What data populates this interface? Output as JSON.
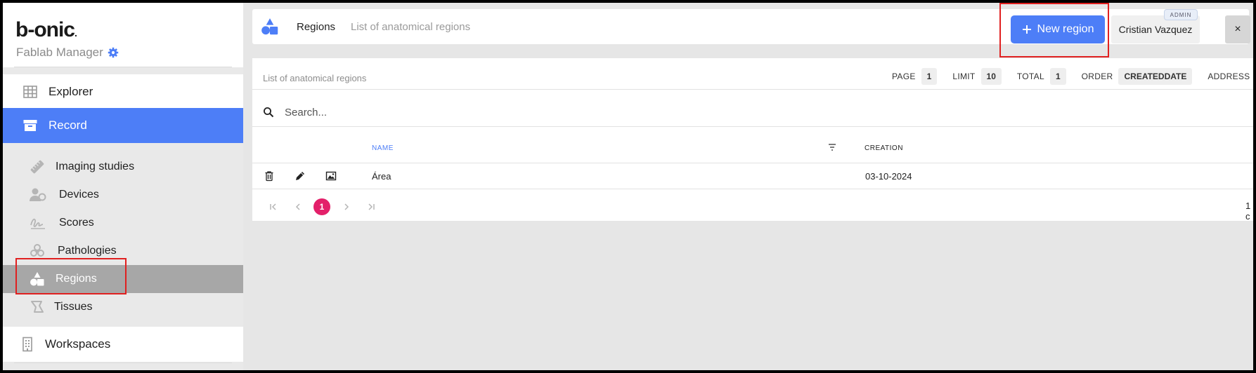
{
  "brand": {
    "logo": "b-onic",
    "subtitle": "Fablab Manager"
  },
  "sidebar": {
    "explorer": "Explorer",
    "record": "Record",
    "sub_items": [
      {
        "label": "Imaging studies",
        "icon": "ruler-icon"
      },
      {
        "label": "Devices",
        "icon": "users-icon"
      },
      {
        "label": "Scores",
        "icon": "signature-icon"
      },
      {
        "label": "Pathologies",
        "icon": "biohazard-icon"
      },
      {
        "label": "Regions",
        "icon": "shapes-icon",
        "active": true
      },
      {
        "label": "Tissues",
        "icon": "tissue-icon"
      }
    ],
    "workspaces": "Workspaces"
  },
  "header": {
    "title": "Regions",
    "description": "List of anatomical regions",
    "new_button": "New region",
    "user": "Cristian Vazquez",
    "role_badge": "ADMIN",
    "close": "×"
  },
  "list": {
    "caption": "List of anatomical regions",
    "stats": {
      "page_label": "PAGE",
      "page": "1",
      "limit_label": "LIMIT",
      "limit": "10",
      "total_label": "TOTAL",
      "total": "1",
      "order_label": "ORDER",
      "order": "CREATEDDATE",
      "address_label": "ADDRESS"
    },
    "search_placeholder": "Search...",
    "columns": {
      "name": "NAME",
      "creation": "CREATION"
    },
    "rows": [
      {
        "name": "Área",
        "creation": "03-10-2024"
      }
    ],
    "pagination": {
      "current": "1",
      "count": "1 c"
    }
  },
  "colors": {
    "accent": "#4d7ef7",
    "page_active": "#e3206a",
    "highlight": "#e02020"
  }
}
